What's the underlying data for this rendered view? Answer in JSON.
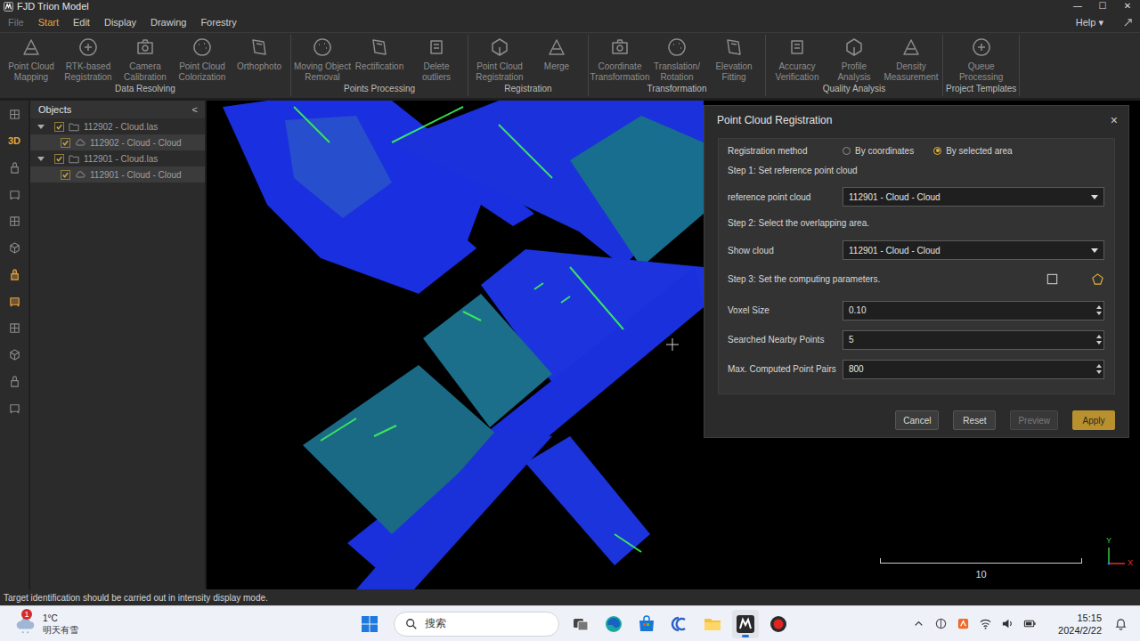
{
  "window": {
    "title": "FJD Trion Model",
    "controls": [
      "—",
      "☐",
      "✕"
    ]
  },
  "menu": [
    {
      "label": "File",
      "selected": false,
      "disabled": true
    },
    {
      "label": "Start",
      "selected": true,
      "disabled": false
    },
    {
      "label": "Edit",
      "selected": false,
      "disabled": false
    },
    {
      "label": "Display",
      "selected": false,
      "disabled": false
    },
    {
      "label": "Drawing",
      "selected": false,
      "disabled": false
    },
    {
      "label": "Forestry",
      "selected": false,
      "disabled": false
    }
  ],
  "help": {
    "label": "Help",
    "caret": "▾"
  },
  "ribbon": [
    {
      "group": "Data Resolving",
      "items": [
        {
          "lines": [
            "Point Cloud",
            "Mapping"
          ]
        },
        {
          "lines": [
            "RTK-based",
            "Registration"
          ]
        },
        {
          "lines": [
            "Camera",
            "Calibration"
          ]
        },
        {
          "lines": [
            "Point Cloud",
            "Colorization"
          ]
        },
        {
          "lines": [
            "Orthophoto"
          ]
        }
      ]
    },
    {
      "group": "Points Processing",
      "items": [
        {
          "lines": [
            "Moving Object",
            "Removal"
          ]
        },
        {
          "lines": [
            "Rectification"
          ]
        },
        {
          "lines": [
            "Delete",
            "outliers"
          ]
        }
      ]
    },
    {
      "group": "Registration",
      "items": [
        {
          "lines": [
            "Point Cloud",
            "Registration"
          ]
        },
        {
          "lines": [
            "Merge"
          ]
        }
      ]
    },
    {
      "group": "Transformation",
      "items": [
        {
          "lines": [
            "Coordinate",
            "Transformation"
          ]
        },
        {
          "lines": [
            "Translation/",
            "Rotation"
          ]
        },
        {
          "lines": [
            "Elevation",
            "Fitting"
          ]
        }
      ]
    },
    {
      "group": "Quality Analysis",
      "items": [
        {
          "lines": [
            "Accuracy",
            "Verification"
          ]
        },
        {
          "lines": [
            "Profile",
            "Analysis"
          ]
        },
        {
          "lines": [
            "Density",
            "Measurement"
          ]
        }
      ]
    },
    {
      "group": "Project Templates",
      "items": [
        {
          "lines": [
            "Queue",
            "Processing"
          ]
        }
      ]
    }
  ],
  "toolbar": [
    {
      "kind": "icon",
      "label": "",
      "highlighted": false
    },
    {
      "kind": "text",
      "label": "3D",
      "highlighted": true
    },
    {
      "kind": "icon",
      "label": "",
      "highlighted": false
    },
    {
      "kind": "icon",
      "label": "",
      "highlighted": false
    },
    {
      "kind": "icon",
      "label": "",
      "highlighted": false
    },
    {
      "kind": "icon",
      "label": "",
      "highlighted": false
    },
    {
      "kind": "icon",
      "label": "",
      "highlighted": true
    },
    {
      "kind": "icon",
      "label": "",
      "highlighted": true
    },
    {
      "kind": "icon",
      "label": "",
      "highlighted": false
    },
    {
      "kind": "icon",
      "label": "",
      "highlighted": false
    },
    {
      "kind": "icon",
      "label": "",
      "highlighted": false
    },
    {
      "kind": "icon",
      "label": "",
      "highlighted": false
    }
  ],
  "objects": {
    "title": "Objects",
    "collapse": "<",
    "tree": [
      {
        "label": "112902 - Cloud.las",
        "level": 0,
        "kind": "file",
        "expanded": true,
        "checked": true,
        "selected": false
      },
      {
        "label": "112902 - Cloud - Cloud",
        "level": 1,
        "kind": "cloud",
        "expanded": false,
        "checked": true,
        "selected": true
      },
      {
        "label": "112901 - Cloud.las",
        "level": 0,
        "kind": "file",
        "expanded": true,
        "checked": true,
        "selected": false
      },
      {
        "label": "112901 - Cloud - Cloud",
        "level": 1,
        "kind": "cloud",
        "expanded": false,
        "checked": true,
        "selected": true
      }
    ]
  },
  "dialog": {
    "title": "Point Cloud Registration",
    "close": "×",
    "method": {
      "label": "Registration method",
      "options": [
        {
          "label": "By coordinates",
          "selected": false
        },
        {
          "label": "By selected area",
          "selected": true
        }
      ]
    },
    "step1": "Step 1: Set reference point cloud",
    "reference": {
      "label": "reference point cloud",
      "value": "112901 - Cloud - Cloud"
    },
    "step2": "Step 2: Select the overlapping area.",
    "show": {
      "label": "Show cloud",
      "value": "112901 - Cloud - Cloud"
    },
    "step3": "Step 3: Set the computing parameters.",
    "select_tools": [
      {
        "kind": "rectangle",
        "selected": false
      },
      {
        "kind": "polygon",
        "selected": true
      }
    ],
    "params": [
      {
        "label": "Voxel Size",
        "value": "0.10"
      },
      {
        "label": "Searched Nearby Points",
        "value": "5"
      },
      {
        "label": "Max. Computed Point Pairs",
        "value": "800"
      }
    ],
    "buttons": [
      {
        "label": "Cancel",
        "disabled": false,
        "primary": false
      },
      {
        "label": "Reset",
        "disabled": false,
        "primary": false
      },
      {
        "label": "Preview",
        "disabled": true,
        "primary": false
      },
      {
        "label": "Apply",
        "disabled": false,
        "primary": true
      }
    ]
  },
  "viewport": {
    "scale": "10",
    "axes": [
      "Y",
      "X"
    ]
  },
  "status_bar": "Target identification should be carried out in intensity display mode.",
  "taskbar": {
    "weather": {
      "badge": "1",
      "temp": "1°C",
      "forecast": "明天有雪"
    },
    "search": "搜索",
    "apps": [
      {
        "kind": "taskview",
        "active": false
      },
      {
        "kind": "edge",
        "active": false
      },
      {
        "kind": "store",
        "active": false
      },
      {
        "kind": "cc",
        "active": false
      },
      {
        "kind": "explorer",
        "active": false
      },
      {
        "kind": "trion",
        "active": true
      },
      {
        "kind": "record",
        "active": false
      }
    ],
    "time": "15:15",
    "date": "2024/2/22"
  }
}
